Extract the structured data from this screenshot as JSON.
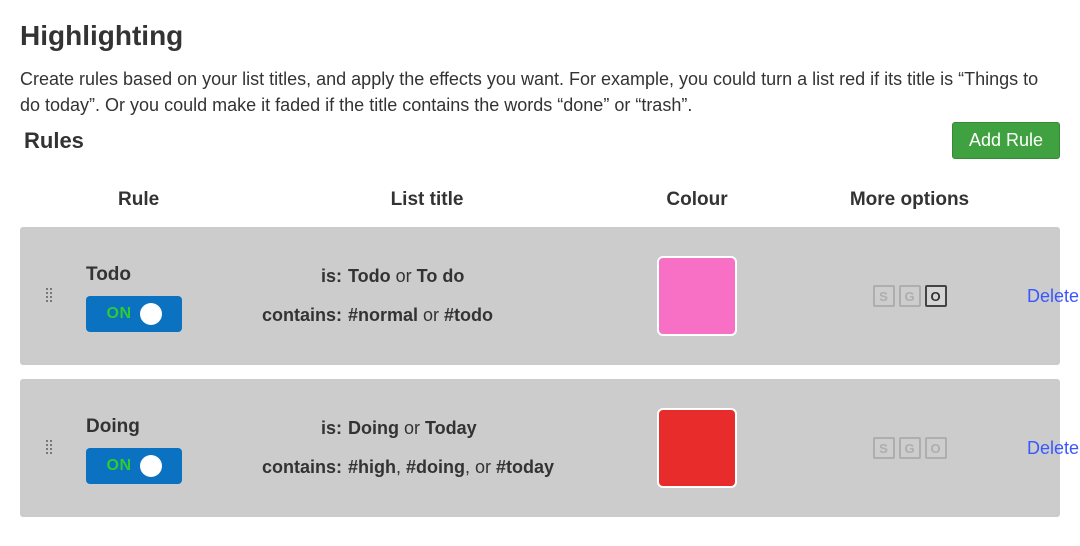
{
  "page": {
    "title": "Highlighting",
    "intro": "Create rules based on your list titles, and apply the effects you want. For example, you could turn a list red if its title is “Things to do today”. Or you could make it faded if the title contains the words “done” or “trash”.",
    "rules_heading": "Rules",
    "add_rule_label": "Add Rule"
  },
  "headers": {
    "rule": "Rule",
    "list_title": "List title",
    "colour": "Colour",
    "more_options": "More options"
  },
  "labels": {
    "is": "is:",
    "contains": "contains:",
    "toggle_on": "ON",
    "delete": "Delete",
    "opt_s": "S",
    "opt_g": "G",
    "opt_o": "O"
  },
  "rules": [
    {
      "name": "Todo",
      "enabled": true,
      "is_html": "<b>Todo</b> or <b>To do</b>",
      "contains_html": "<b>#normal</b> or <b>#todo</b>",
      "colour": "#f770c6",
      "opts": {
        "s": false,
        "g": false,
        "o": true
      }
    },
    {
      "name": "Doing",
      "enabled": true,
      "is_html": "<b>Doing</b> or <b>Today</b>",
      "contains_html": "<b>#high</b>, <b>#doing</b>, or <b>#today</b>",
      "colour": "#e82c2c",
      "opts": {
        "s": false,
        "g": false,
        "o": false
      }
    }
  ]
}
